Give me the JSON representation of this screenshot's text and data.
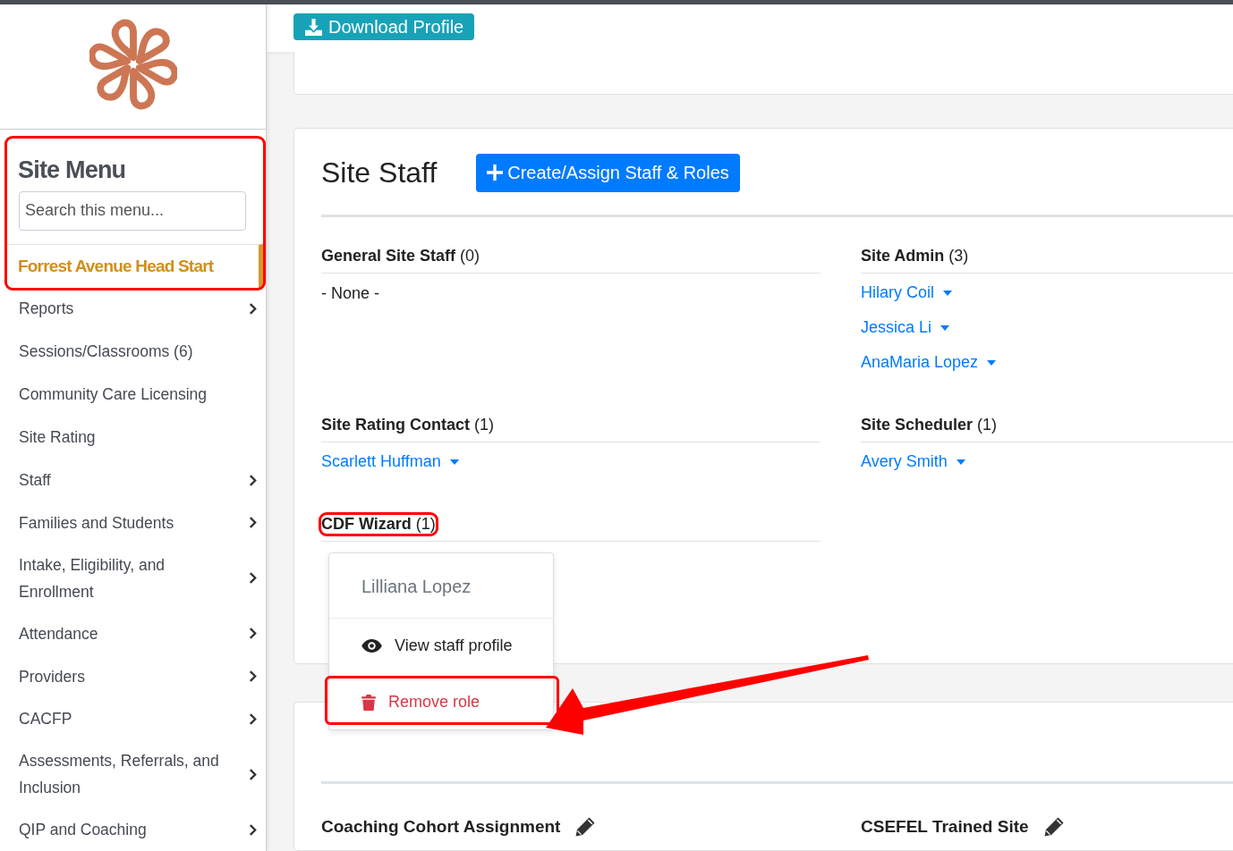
{
  "download_button": {
    "label": "Download Profile"
  },
  "sidebar": {
    "title": "Site Menu",
    "highlighted": true,
    "search": {
      "placeholder": "Search this menu..."
    },
    "site": {
      "label": "Forrest Avenue Head Start",
      "selected": true
    },
    "items": [
      {
        "label": "Reports",
        "has_submenu": true
      },
      {
        "label": "Sessions/Classrooms (6)",
        "has_submenu": false
      },
      {
        "label": "Community Care Licensing",
        "has_submenu": false
      },
      {
        "label": "Site Rating",
        "has_submenu": false
      },
      {
        "label": "Staff",
        "has_submenu": true
      },
      {
        "label": "Families and Students",
        "has_submenu": true
      },
      {
        "label": "Intake, Eligibility, and Enrollment",
        "has_submenu": true
      },
      {
        "label": "Attendance",
        "has_submenu": true
      },
      {
        "label": "Providers",
        "has_submenu": true
      },
      {
        "label": "CACFP",
        "has_submenu": true
      },
      {
        "label": "Assessments, Referrals, and Inclusion",
        "has_submenu": true
      },
      {
        "label": "QIP and Coaching",
        "has_submenu": true
      }
    ]
  },
  "staff_card": {
    "title": "Site Staff",
    "create_button": "Create/Assign Staff & Roles",
    "groups": [
      {
        "name": "General Site Staff",
        "count": "(0)",
        "highlighted": false,
        "empty_text": "- None -"
      },
      {
        "name": "Site Admin",
        "count": "(3)",
        "highlighted": false,
        "members": [
          "Hilary Coil",
          "Jessica Li",
          "AnaMaria Lopez"
        ]
      },
      {
        "name": "Site Rating Contact",
        "count": "(1)",
        "highlighted": false,
        "members": [
          "Scarlett Huffman"
        ]
      },
      {
        "name": "Site Scheduler",
        "count": "(1)",
        "highlighted": false,
        "members": [
          "Avery Smith"
        ]
      },
      {
        "name": "CDF Wizard",
        "count": "(1)",
        "highlighted": true,
        "dropdown": {
          "header": "Lilliana Lopez",
          "items": [
            {
              "kind": "view",
              "label": "View staff profile",
              "highlighted": false
            },
            {
              "kind": "danger",
              "label": "Remove role",
              "highlighted": true
            }
          ]
        }
      }
    ]
  },
  "custom_fields": {
    "fields": [
      {
        "label": "Coaching Cohort Assignment"
      },
      {
        "label": "CSEFEL Trained Site"
      }
    ]
  }
}
